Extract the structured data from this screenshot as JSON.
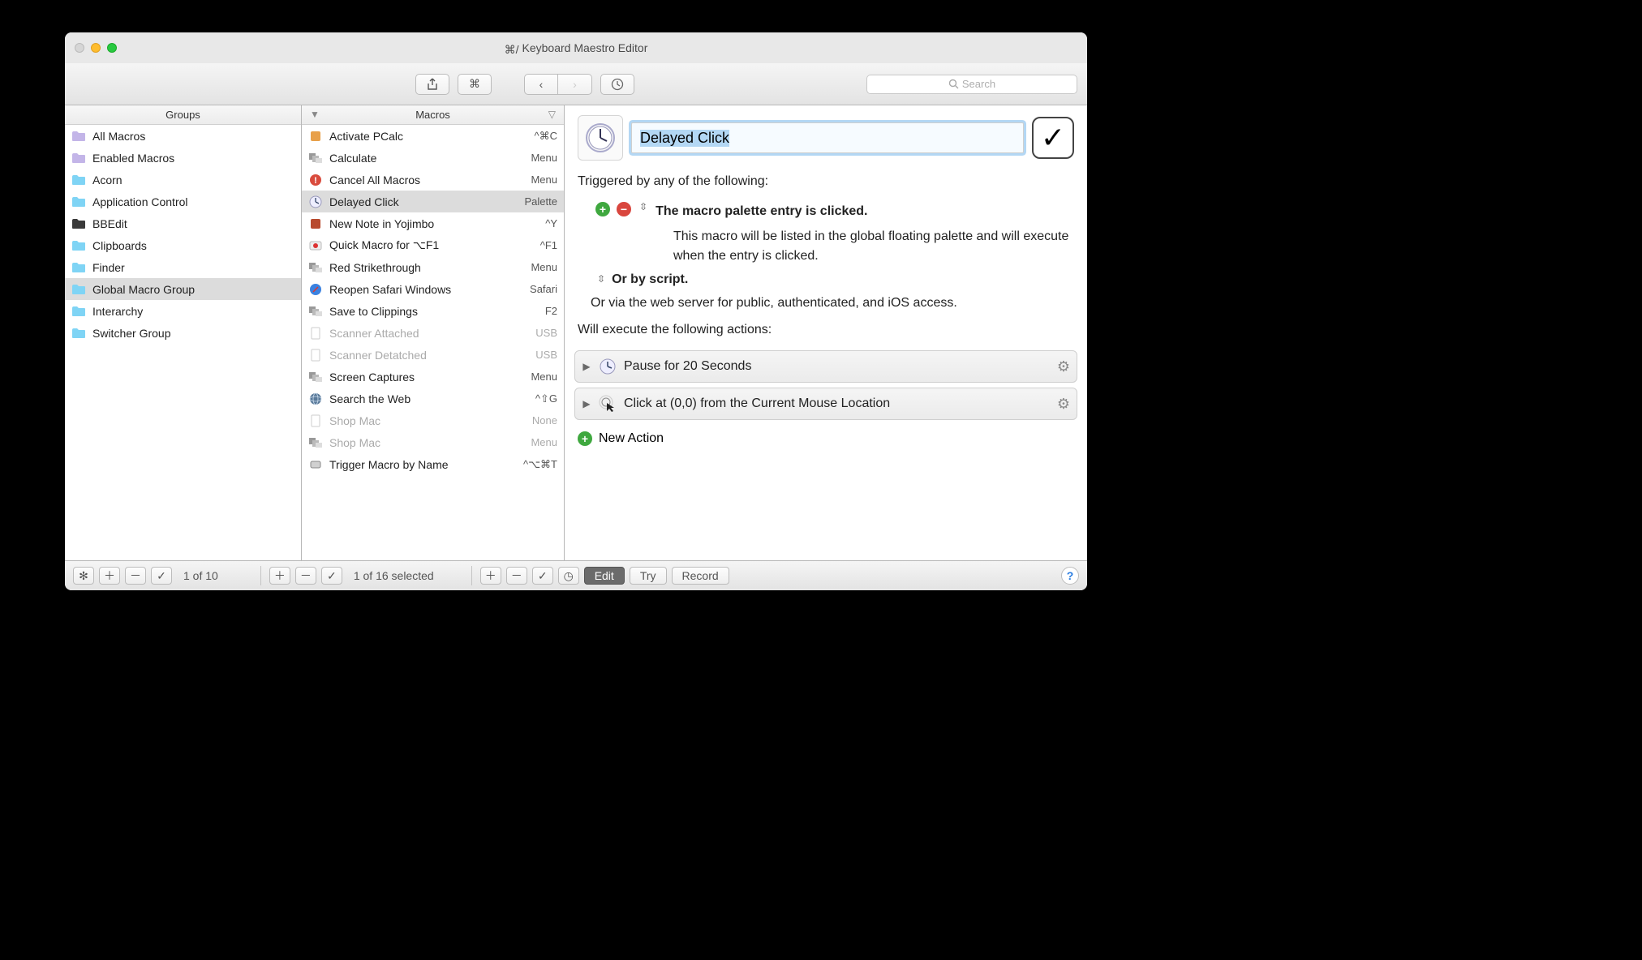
{
  "window": {
    "title": "Keyboard Maestro Editor"
  },
  "search": {
    "placeholder": "Search"
  },
  "columns": {
    "groups": "Groups",
    "macros": "Macros"
  },
  "groups": [
    {
      "label": "All Macros",
      "icon": "purple"
    },
    {
      "label": "Enabled Macros",
      "icon": "purple"
    },
    {
      "label": "Acorn",
      "icon": "blue"
    },
    {
      "label": "Application Control",
      "icon": "blue"
    },
    {
      "label": "BBEdit",
      "icon": "dark"
    },
    {
      "label": "Clipboards",
      "icon": "blue"
    },
    {
      "label": "Finder",
      "icon": "blue"
    },
    {
      "label": "Global Macro Group",
      "icon": "blue",
      "selected": true
    },
    {
      "label": "Interarchy",
      "icon": "blue"
    },
    {
      "label": "Switcher Group",
      "icon": "blue"
    }
  ],
  "macros": [
    {
      "label": "Activate PCalc",
      "shortcut": "^⌘C",
      "icon": "app"
    },
    {
      "label": "Calculate",
      "shortcut": "Menu",
      "icon": "stack"
    },
    {
      "label": "Cancel All Macros",
      "shortcut": "Menu",
      "icon": "alert"
    },
    {
      "label": "Delayed Click",
      "shortcut": "Palette",
      "icon": "clock",
      "selected": true
    },
    {
      "label": "New Note in Yojimbo",
      "shortcut": "^Y",
      "icon": "yojimbo"
    },
    {
      "label": "Quick Macro for ⌥F1",
      "shortcut": "^F1",
      "icon": "record"
    },
    {
      "label": "Red Strikethrough",
      "shortcut": "Menu",
      "icon": "stack"
    },
    {
      "label": "Reopen Safari Windows",
      "shortcut": "Safari",
      "icon": "safari"
    },
    {
      "label": "Save to Clippings",
      "shortcut": "F2",
      "icon": "stack"
    },
    {
      "label": "Scanner Attached",
      "shortcut": "USB",
      "icon": "page",
      "dim": true
    },
    {
      "label": "Scanner Detatched",
      "shortcut": "USB",
      "icon": "page",
      "dim": true
    },
    {
      "label": "Screen Captures",
      "shortcut": "Menu",
      "icon": "stack"
    },
    {
      "label": "Search the Web",
      "shortcut": "^⇧G",
      "icon": "globe"
    },
    {
      "label": "Shop Mac",
      "shortcut": "None",
      "icon": "page",
      "dim": true
    },
    {
      "label": "Shop Mac",
      "shortcut": "Menu",
      "icon": "stack",
      "dim": true
    },
    {
      "label": "Trigger Macro by Name",
      "shortcut": "^⌥⌘T",
      "icon": "hdd"
    }
  ],
  "detail": {
    "name": "Delayed Click",
    "triggered_by": "Triggered by any of the following:",
    "trigger1": "The macro palette entry is clicked.",
    "trigger1_desc": "This macro will be listed in the global floating palette and will execute when the entry is clicked.",
    "or_script": "Or by script.",
    "via_web": "Or via the web server for public, authenticated, and iOS access.",
    "will_execute": "Will execute the following actions:",
    "action1": "Pause for 20 Seconds",
    "action2": "Click at (0,0) from the Current Mouse Location",
    "new_action": "New Action"
  },
  "footer": {
    "groups_status": "1 of 10",
    "macros_status": "1 of 16 selected",
    "edit": "Edit",
    "try": "Try",
    "record": "Record"
  }
}
